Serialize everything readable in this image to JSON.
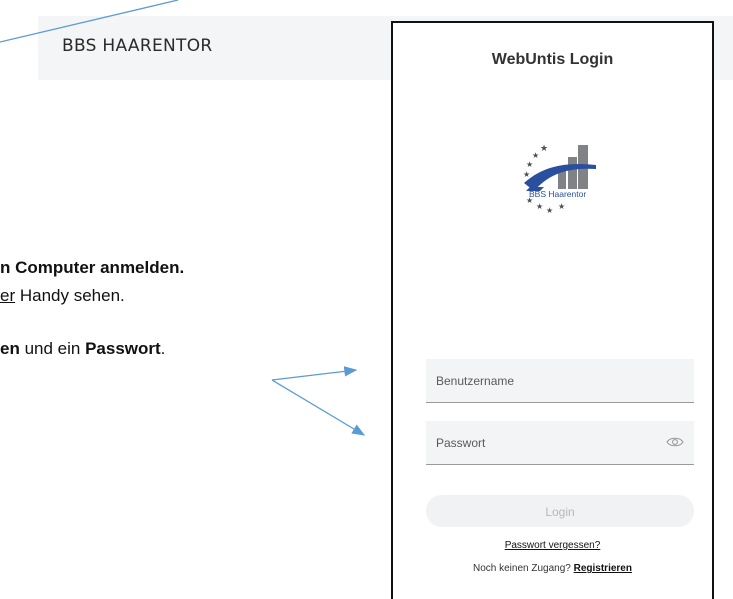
{
  "website": {
    "school_name": "BBS HAARENTOR"
  },
  "document": {
    "line1_bold": "n Computer anmelden.",
    "line2_underlined": "er",
    "line2_rest": " Handy sehen.",
    "line3_bold1": "en",
    "line3_mid": " und ein ",
    "line3_bold2": "Passwort",
    "line3_end": "."
  },
  "login_dialog": {
    "title": "WebUntis Login",
    "logo_text": "BBS Haarentor",
    "username_placeholder": "Benutzername",
    "password_placeholder": "Passwort",
    "login_label": "Login",
    "forgot_password": "Passwort vergessen?",
    "no_access_text": "Noch keinen Zugang? ",
    "register_link": "Registrieren"
  },
  "colors": {
    "arrow": "#5b9bd5",
    "logo_blue": "#2a4f9e",
    "logo_gray": "#808285"
  },
  "icons": {
    "password_toggle": "eye-icon"
  }
}
